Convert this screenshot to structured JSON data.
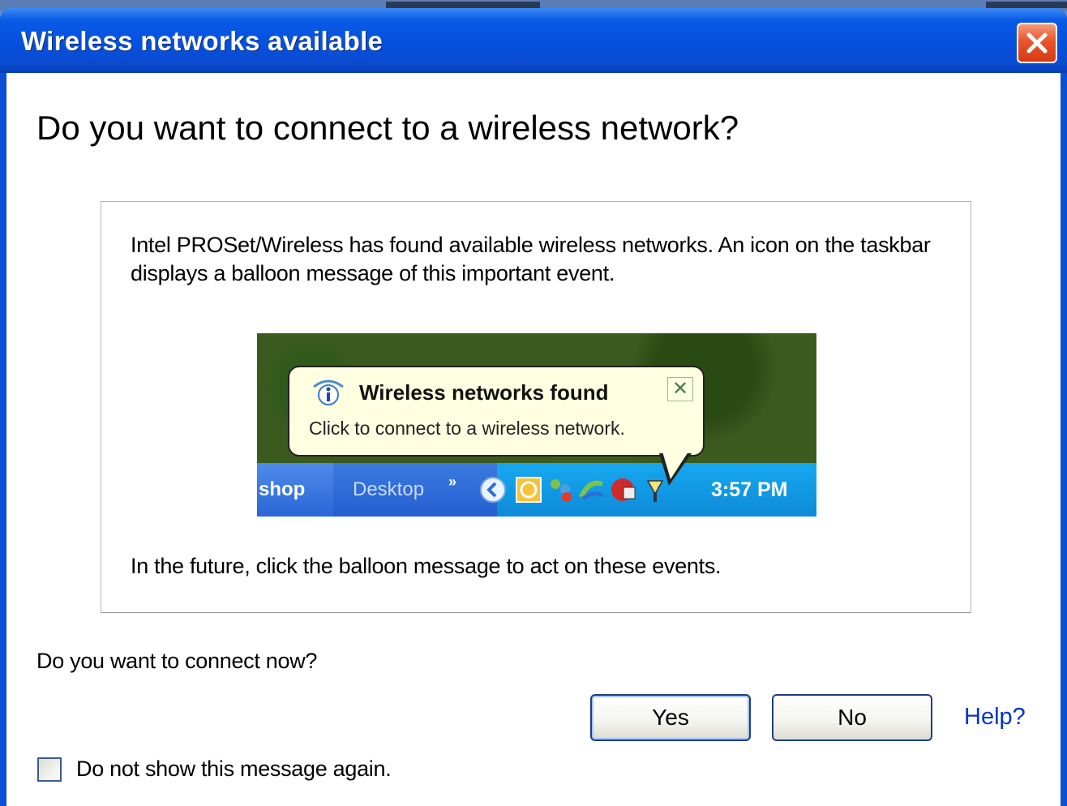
{
  "window": {
    "title": "Wireless networks available",
    "close_icon": "close-icon"
  },
  "heading": "Do you want to connect to a wireless network?",
  "panel": {
    "message": "Intel PROSet/Wireless has found available wireless networks. An icon on the taskbar displays a balloon message of this important event.",
    "future_text": "In the future, click the balloon message to act on these events.",
    "screenshot": {
      "balloon_title": "Wireless networks found",
      "balloon_text": "Click to connect to a wireless network.",
      "balloon_close": "✕",
      "taskbar_item_1": "shop",
      "taskbar_item_2": "Desktop",
      "taskbar_chevron": "»",
      "clock": "3:57 PM"
    }
  },
  "question": "Do you want to connect now?",
  "buttons": {
    "yes": "Yes",
    "no": "No",
    "help": "Help?"
  },
  "checkbox": {
    "label": "Do not show this message again.",
    "checked": false
  },
  "colors": {
    "titlebar": "#0650de",
    "close_button": "#e8542c",
    "link": "#0033cc",
    "balloon": "#ffffe1",
    "tray": "#0d8bd8"
  }
}
